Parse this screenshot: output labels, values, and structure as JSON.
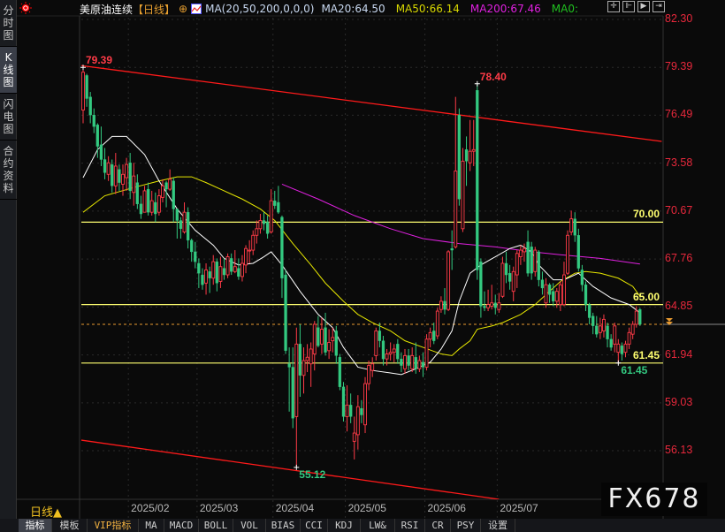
{
  "sidebar": {
    "tabs": [
      {
        "label": "分时图"
      },
      {
        "label": "K线图",
        "active": true
      },
      {
        "label": "闪电图"
      },
      {
        "label": "合约资料"
      }
    ]
  },
  "header": {
    "instrument": "美原油连续",
    "period": "【日线】",
    "indicator": "MA(20,50,200,0,0,0)",
    "ma20": "MA20:64.50",
    "ma50": "MA50:66.14",
    "ma200": "MA200:67.46",
    "ma0": "MA0:"
  },
  "toolbar_icons": [
    "crosshair-icon",
    "zoom-in-icon",
    "play-forward-icon",
    "jump-end-icon"
  ],
  "period_selector": "日线▲",
  "watermark": "FX678",
  "bottom_toolbar": [
    {
      "label": "指标",
      "active": true
    },
    {
      "label": "模板"
    },
    {
      "label": "VIP指标",
      "vip": true
    },
    {
      "label": "MA"
    },
    {
      "label": "MACD"
    },
    {
      "label": "BOLL"
    },
    {
      "label": "VOL"
    },
    {
      "label": "BIAS"
    },
    {
      "label": "CCI"
    },
    {
      "label": "KDJ"
    },
    {
      "label": "LW&"
    },
    {
      "label": "RSI"
    },
    {
      "label": "CR"
    },
    {
      "label": "PSY"
    },
    {
      "label": "设置"
    }
  ],
  "colors": {
    "up": "#ff3b47",
    "down": "#33c980",
    "ma20": "#ffffff",
    "ma50": "#e6e600",
    "ma200": "#e020e0",
    "level": "#ffff70",
    "trend": "#ff1a1a",
    "axis": "#e8283c",
    "last": "#e89a30"
  },
  "chart_data": {
    "type": "candlestick",
    "yticks": [
      "82.30",
      "79.39",
      "76.49",
      "73.58",
      "70.67",
      "67.76",
      "64.85",
      "61.94",
      "59.03",
      "56.13"
    ],
    "ylim": [
      56.13,
      82.3
    ],
    "xticks": [
      "2025/02",
      "2025/03",
      "2025/04",
      "2025/05",
      "2025/06",
      "2025/07"
    ],
    "xtick_bar_index": [
      13,
      32,
      53,
      73,
      95,
      115
    ],
    "candle_fields": [
      "open",
      "close",
      "high",
      "low"
    ],
    "candles": [
      [
        76.8,
        79.1,
        79.39,
        76.0
      ],
      [
        78.9,
        77.5,
        79.0,
        77.0
      ],
      [
        77.6,
        76.5,
        77.9,
        76.0
      ],
      [
        76.5,
        75.8,
        76.9,
        75.4
      ],
      [
        75.9,
        74.6,
        76.0,
        73.9
      ],
      [
        74.7,
        73.8,
        75.8,
        73.4
      ],
      [
        73.8,
        73.0,
        74.5,
        72.6
      ],
      [
        72.9,
        73.6,
        74.0,
        72.5
      ],
      [
        73.5,
        72.2,
        73.8,
        71.8
      ],
      [
        72.2,
        73.4,
        74.2,
        71.7
      ],
      [
        73.2,
        72.4,
        73.5,
        71.9
      ],
      [
        72.3,
        72.9,
        73.5,
        71.6
      ],
      [
        72.7,
        73.5,
        73.9,
        71.9
      ],
      [
        73.6,
        71.9,
        74.2,
        71.4
      ],
      [
        71.8,
        72.8,
        73.6,
        71.0
      ],
      [
        72.4,
        71.1,
        72.9,
        70.8
      ],
      [
        71.1,
        70.5,
        71.6,
        70.2
      ],
      [
        70.6,
        71.9,
        72.2,
        70.6
      ],
      [
        72.0,
        70.6,
        72.4,
        70.4
      ],
      [
        70.6,
        71.3,
        71.9,
        70.4
      ],
      [
        71.2,
        70.5,
        71.8,
        70.0
      ],
      [
        70.6,
        71.6,
        72.0,
        70.4
      ],
      [
        71.5,
        72.2,
        72.6,
        71.2
      ],
      [
        72.4,
        72.0,
        72.5,
        70.9
      ],
      [
        72.0,
        72.6,
        73.2,
        71.9
      ],
      [
        72.5,
        70.8,
        72.7,
        70.0
      ],
      [
        70.8,
        70.1,
        70.8,
        69.0
      ],
      [
        70.1,
        69.6,
        70.3,
        69.0
      ],
      [
        69.4,
        70.6,
        71.2,
        69.3
      ],
      [
        70.6,
        68.9,
        70.9,
        68.4
      ],
      [
        68.9,
        68.2,
        69.0,
        67.6
      ],
      [
        68.2,
        67.6,
        68.8,
        67.2
      ],
      [
        67.5,
        66.9,
        67.8,
        66.0
      ],
      [
        66.8,
        66.2,
        67.2,
        65.9
      ],
      [
        66.3,
        67.1,
        67.5,
        65.6
      ],
      [
        67.0,
        66.6,
        67.3,
        65.7
      ],
      [
        66.6,
        67.6,
        68.0,
        66.2
      ],
      [
        67.6,
        66.3,
        67.8,
        65.8
      ],
      [
        66.4,
        67.3,
        67.9,
        66.0
      ],
      [
        67.2,
        66.8,
        67.8,
        66.5
      ],
      [
        66.8,
        67.9,
        68.1,
        66.6
      ],
      [
        67.8,
        67.0,
        68.1,
        66.8
      ],
      [
        67.0,
        67.3,
        68.3,
        66.9
      ],
      [
        67.2,
        66.7,
        67.8,
        66.5
      ],
      [
        66.7,
        67.5,
        68.0,
        66.4
      ],
      [
        67.4,
        68.4,
        68.6,
        66.9
      ],
      [
        68.3,
        68.3,
        68.9,
        67.5
      ],
      [
        68.3,
        69.2,
        69.5,
        68.0
      ],
      [
        69.2,
        69.6,
        70.1,
        68.7
      ],
      [
        69.6,
        70.1,
        70.5,
        69.3
      ],
      [
        70.1,
        69.9,
        70.6,
        69.5
      ],
      [
        70.0,
        69.3,
        70.4,
        69.0
      ],
      [
        69.4,
        71.3,
        72.0,
        69.3
      ],
      [
        71.3,
        71.0,
        71.9,
        70.8
      ],
      [
        71.2,
        70.6,
        72.2,
        70.5
      ],
      [
        70.3,
        66.6,
        70.4,
        65.4
      ],
      [
        66.8,
        62.2,
        67.1,
        62.0
      ],
      [
        61.4,
        61.2,
        62.4,
        58.5
      ],
      [
        61.2,
        58.1,
        62.4,
        57.5
      ],
      [
        58.2,
        62.6,
        63.6,
        55.12
      ],
      [
        62.6,
        60.7,
        63.8,
        59.4
      ],
      [
        60.7,
        61.6,
        62.4,
        59.6
      ],
      [
        61.6,
        61.8,
        62.6,
        60.9
      ],
      [
        61.4,
        62.3,
        62.7,
        60.0
      ],
      [
        62.0,
        63.8,
        64.0,
        61.0
      ],
      [
        63.6,
        62.5,
        64.3,
        62.4
      ],
      [
        62.6,
        63.5,
        64.2,
        62.0
      ],
      [
        63.6,
        62.1,
        64.5,
        61.9
      ],
      [
        62.2,
        62.7,
        63.5,
        61.7
      ],
      [
        62.8,
        63.0,
        63.6,
        62.1
      ],
      [
        63.4,
        61.9,
        63.7,
        61.4
      ],
      [
        61.8,
        60.0,
        62.0,
        59.8
      ],
      [
        60.0,
        58.2,
        60.3,
        57.9
      ],
      [
        58.2,
        58.9,
        60.1,
        57.3
      ],
      [
        58.9,
        58.2,
        59.6,
        57.8
      ],
      [
        56.7,
        57.2,
        58.2,
        55.6
      ],
      [
        57.1,
        58.8,
        59.5,
        56.2
      ],
      [
        58.7,
        58.3,
        59.2,
        57.8
      ],
      [
        57.7,
        60.2,
        60.6,
        57.2
      ],
      [
        60.2,
        61.3,
        61.6,
        59.8
      ],
      [
        61.0,
        61.4,
        61.8,
        60.6
      ],
      [
        61.9,
        63.4,
        63.6,
        61.6
      ],
      [
        63.4,
        62.8,
        63.9,
        62.4
      ],
      [
        62.8,
        61.7,
        63.1,
        61.3
      ],
      [
        61.7,
        62.0,
        62.3,
        61.3
      ],
      [
        62.0,
        62.1,
        62.7,
        61.6
      ],
      [
        62.1,
        62.3,
        62.6,
        61.5
      ],
      [
        62.6,
        61.7,
        62.9,
        61.4
      ],
      [
        61.7,
        61.3,
        62.1,
        60.9
      ],
      [
        61.1,
        61.9,
        62.3,
        60.8
      ],
      [
        61.9,
        61.3,
        62.3,
        61.0
      ],
      [
        61.1,
        61.9,
        62.4,
        60.9
      ],
      [
        61.8,
        61.1,
        62.7,
        60.8
      ],
      [
        61.1,
        61.6,
        61.9,
        60.9
      ],
      [
        61.5,
        61.2,
        62.1,
        60.6
      ],
      [
        61.2,
        62.9,
        63.2,
        61.0
      ],
      [
        62.9,
        63.3,
        63.6,
        62.4
      ],
      [
        63.4,
        62.8,
        63.9,
        62.6
      ],
      [
        63.1,
        64.6,
        64.8,
        62.9
      ],
      [
        64.7,
        65.2,
        65.5,
        64.5
      ],
      [
        65.2,
        64.7,
        66.0,
        64.4
      ],
      [
        64.7,
        68.2,
        68.3,
        64.6
      ],
      [
        68.4,
        68.3,
        69.5,
        67.1
      ],
      [
        68.5,
        73.1,
        77.6,
        68.4
      ],
      [
        76.5,
        71.4,
        76.9,
        71.0
      ],
      [
        69.6,
        73.7,
        74.5,
        69.4
      ],
      [
        74.4,
        73.7,
        75.2,
        72.2
      ],
      [
        73.6,
        74.3,
        76.2,
        73.1
      ],
      [
        74.3,
        74.4,
        76.2,
        73.4
      ],
      [
        78.0,
        67.1,
        78.4,
        66.5
      ],
      [
        67.6,
        64.9,
        67.8,
        64.2
      ],
      [
        64.9,
        64.8,
        65.8,
        64.6
      ],
      [
        64.8,
        65.0,
        65.9,
        64.6
      ],
      [
        64.9,
        65.1,
        66.2,
        64.7
      ],
      [
        65.1,
        64.8,
        65.6,
        64.4
      ],
      [
        64.7,
        65.1,
        65.7,
        64.5
      ],
      [
        65.5,
        67.5,
        67.9,
        65.4
      ],
      [
        67.5,
        66.8,
        68.2,
        66.3
      ],
      [
        66.9,
        66.4,
        67.4,
        65.9
      ],
      [
        65.8,
        67.0,
        67.3,
        65.2
      ],
      [
        66.8,
        68.1,
        68.3,
        66.0
      ],
      [
        67.9,
        68.3,
        68.6,
        67.4
      ],
      [
        68.2,
        68.4,
        68.7,
        67.6
      ],
      [
        68.8,
        66.9,
        69.5,
        66.7
      ],
      [
        68.5,
        66.9,
        68.8,
        66.5
      ],
      [
        67.0,
        68.3,
        68.5,
        66.7
      ],
      [
        68.2,
        66.5,
        68.3,
        66.1
      ],
      [
        66.5,
        66.0,
        67.0,
        65.6
      ],
      [
        65.1,
        66.2,
        66.6,
        64.8
      ],
      [
        66.2,
        65.6,
        66.3,
        65.1
      ],
      [
        65.8,
        65.2,
        66.3,
        64.9
      ],
      [
        65.2,
        65.8,
        66.0,
        64.8
      ],
      [
        65.0,
        66.2,
        66.4,
        64.6
      ],
      [
        65.0,
        66.8,
        67.6,
        64.9
      ],
      [
        66.9,
        69.2,
        69.5,
        66.8
      ],
      [
        69.4,
        70.2,
        70.7,
        69.2
      ],
      [
        70.2,
        69.2,
        70.6,
        68.8
      ],
      [
        69.2,
        67.2,
        69.6,
        67.0
      ],
      [
        67.1,
        66.2,
        67.4,
        65.8
      ],
      [
        66.2,
        65.0,
        66.4,
        64.6
      ],
      [
        65.0,
        64.2,
        65.1,
        63.8
      ],
      [
        64.3,
        63.7,
        64.5,
        63.2
      ],
      [
        63.7,
        63.2,
        64.3,
        63.0
      ],
      [
        63.3,
        63.7,
        64.2,
        62.9
      ],
      [
        63.4,
        64.1,
        64.4,
        63.0
      ],
      [
        63.7,
        62.9,
        63.9,
        62.4
      ],
      [
        62.9,
        62.4,
        63.2,
        62.2
      ],
      [
        62.6,
        63.7,
        63.9,
        62.1
      ],
      [
        62.1,
        62.6,
        62.9,
        61.45
      ],
      [
        62.5,
        62.0,
        62.7,
        61.6
      ],
      [
        62.1,
        62.6,
        62.8,
        61.8
      ],
      [
        62.6,
        63.3,
        63.6,
        62.3
      ],
      [
        63.2,
        63.8,
        64.0,
        62.9
      ],
      [
        63.8,
        64.6,
        64.9,
        63.6
      ],
      [
        64.7,
        63.8,
        64.8,
        63.7
      ]
    ],
    "ma20": [
      [
        0,
        72.7
      ],
      [
        4,
        74.4
      ],
      [
        8,
        75.2
      ],
      [
        12,
        75.2
      ],
      [
        17,
        74.1
      ],
      [
        21,
        72.5
      ],
      [
        26,
        70.8
      ],
      [
        31,
        69.5
      ],
      [
        36,
        68.6
      ],
      [
        39,
        67.8
      ],
      [
        43,
        67.4
      ],
      [
        47,
        67.5
      ],
      [
        50,
        67.9
      ],
      [
        52,
        68.2
      ],
      [
        55,
        67.4
      ],
      [
        60,
        65.8
      ],
      [
        65,
        64.4
      ],
      [
        69,
        63.6
      ],
      [
        72,
        62.4
      ],
      [
        76,
        61.2
      ],
      [
        80,
        61.0
      ],
      [
        85,
        60.85
      ],
      [
        88,
        60.75
      ],
      [
        92,
        61.1
      ],
      [
        96,
        61.5
      ],
      [
        99,
        62.3
      ],
      [
        102,
        63.4
      ],
      [
        104,
        65.2
      ],
      [
        107,
        66.9
      ],
      [
        110,
        67.4
      ],
      [
        114,
        67.9
      ],
      [
        118,
        68.4
      ],
      [
        121,
        68.6
      ],
      [
        124,
        68.2
      ],
      [
        126,
        67.4
      ],
      [
        130,
        66.5
      ],
      [
        133,
        66.5
      ],
      [
        137,
        66.9
      ],
      [
        141,
        66.1
      ],
      [
        146,
        65.4
      ],
      [
        151,
        65.0
      ],
      [
        154,
        64.5
      ]
    ],
    "ma50": [
      [
        0,
        70.6
      ],
      [
        6,
        71.6
      ],
      [
        14,
        72.1
      ],
      [
        21,
        72.5
      ],
      [
        26,
        72.75
      ],
      [
        30,
        72.75
      ],
      [
        34,
        72.4
      ],
      [
        39,
        71.9
      ],
      [
        44,
        71.4
      ],
      [
        49,
        70.8
      ],
      [
        53,
        70.1
      ],
      [
        58,
        68.7
      ],
      [
        63,
        67.4
      ],
      [
        67,
        66.3
      ],
      [
        72,
        65.2
      ],
      [
        76,
        64.4
      ],
      [
        80,
        63.9
      ],
      [
        85,
        63.4
      ],
      [
        89,
        62.8
      ],
      [
        94,
        62.4
      ],
      [
        99,
        62.0
      ],
      [
        102,
        61.9
      ],
      [
        104,
        62.3
      ],
      [
        107,
        62.8
      ],
      [
        109,
        63.5
      ],
      [
        113,
        63.7
      ],
      [
        116,
        63.9
      ],
      [
        121,
        64.4
      ],
      [
        125,
        65.0
      ],
      [
        129,
        65.8
      ],
      [
        132,
        66.4
      ],
      [
        136,
        66.9
      ],
      [
        139,
        67.0
      ],
      [
        143,
        66.9
      ],
      [
        148,
        66.6
      ],
      [
        152,
        66.1
      ],
      [
        154,
        65.5
      ]
    ],
    "ma200": [
      [
        55,
        72.3
      ],
      [
        65,
        71.4
      ],
      [
        75,
        70.4
      ],
      [
        85,
        69.6
      ],
      [
        94,
        69.0
      ],
      [
        104,
        68.7
      ],
      [
        114,
        68.5
      ],
      [
        124,
        68.2
      ],
      [
        133,
        68.0
      ],
      [
        143,
        67.8
      ],
      [
        154,
        67.46
      ]
    ],
    "levels": [
      {
        "value": 70.0,
        "label": "70.00"
      },
      {
        "value": 65.0,
        "label": "65.00"
      },
      {
        "value": 61.45,
        "label": "61.45"
      }
    ],
    "trendlines": [
      [
        [
          -0.5,
          79.5
        ],
        [
          160,
          74.9
        ]
      ],
      [
        [
          -0.5,
          56.77
        ],
        [
          115,
          53.18
        ]
      ]
    ],
    "last_price": 63.8,
    "annotations": [
      {
        "label": "79.39",
        "bar": 0,
        "value": 79.39,
        "color": "up"
      },
      {
        "label": "78.40",
        "bar": 109,
        "value": 78.4,
        "color": "up"
      },
      {
        "label": "55.12",
        "bar": 59,
        "value": 55.12,
        "color": "down"
      },
      {
        "label": "61.45",
        "bar": 148,
        "value": 61.45,
        "color": "down"
      }
    ]
  }
}
